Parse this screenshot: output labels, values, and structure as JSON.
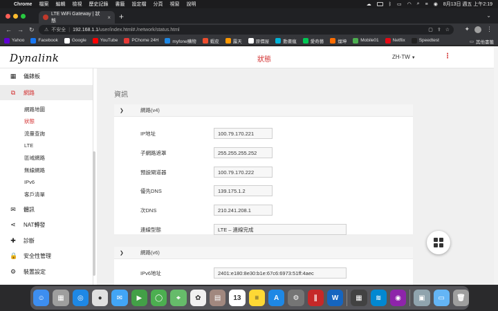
{
  "menubar": {
    "app": "Chrome",
    "menus": [
      "檔案",
      "編輯",
      "檢視",
      "歷史記錄",
      "書籤",
      "設定檔",
      "分頁",
      "視窗",
      "說明"
    ],
    "clock": "8月13日 週五 上午2:19"
  },
  "tab": {
    "title": "LTE WiFi Gateway | 狀態",
    "close": "×",
    "new": "+"
  },
  "toolbar": {
    "security": "不安全",
    "host": "192.168.1.1",
    "path": "/user/index.html#./network/status.html"
  },
  "bookmarks": [
    {
      "label": "Yahoo",
      "color": "#6001d2"
    },
    {
      "label": "Facebook",
      "color": "#1877f2"
    },
    {
      "label": "Google",
      "color": "#ffffff"
    },
    {
      "label": "YouTube",
      "color": "#ff0000"
    },
    {
      "label": "PChome 24H",
      "color": "#e53935"
    },
    {
      "label": "myfone購物",
      "color": "#1e88e5"
    },
    {
      "label": "蝦皮",
      "color": "#ee4d2d"
    },
    {
      "label": "露天",
      "color": "#ff9800"
    },
    {
      "label": "原價屋",
      "color": "#ffffff"
    },
    {
      "label": "動畫瘋",
      "color": "#00b4d8"
    },
    {
      "label": "愛奇藝",
      "color": "#00c853"
    },
    {
      "label": "燦坤",
      "color": "#ff6d00"
    },
    {
      "label": "Mobile01",
      "color": "#4caf50"
    },
    {
      "label": "Netflix",
      "color": "#e50914"
    },
    {
      "label": "Speedtest",
      "color": "#212121"
    }
  ],
  "other_bookmarks": "其他書籤",
  "header": {
    "logo": "Dynalink",
    "title": "狀態",
    "language": "ZH-TW"
  },
  "sidebar": {
    "items": [
      {
        "label": "儀錶板",
        "icon": "dashboard-icon"
      },
      {
        "label": "網路",
        "icon": "network-icon"
      },
      {
        "label": "體訊",
        "icon": "mail-icon"
      },
      {
        "label": "NAT轉發",
        "icon": "share-icon"
      },
      {
        "label": "診斷",
        "icon": "diagnostic-icon"
      },
      {
        "label": "安全性管理",
        "icon": "lock-icon"
      },
      {
        "label": "裝置設定",
        "icon": "gear-icon"
      }
    ],
    "subitems": [
      "網路地圖",
      "狀態",
      "流量查詢",
      "LTE",
      "區域網路",
      "無線網路",
      "IPv6",
      "客戶清單"
    ]
  },
  "main": {
    "section_title": "資訊",
    "v4": {
      "title": "網路(v4)",
      "rows": [
        {
          "label": "IP地址",
          "value": "100.79.170.221"
        },
        {
          "label": "子網路遮罩",
          "value": "255.255.255.252"
        },
        {
          "label": "預設閘道器",
          "value": "100.79.170.222"
        },
        {
          "label": "優先DNS",
          "value": "139.175.1.2"
        },
        {
          "label": "次DNS",
          "value": "210.241.208.1"
        },
        {
          "label": "連線型態",
          "value": "LTE – 連線完成"
        }
      ]
    },
    "v6": {
      "title": "網路(v6)",
      "rows": [
        {
          "label": "IPv6地址",
          "value": "2401:e180:8e30:b1e:67c6:6973:51ff:4aec"
        }
      ]
    }
  },
  "dock": [
    {
      "name": "finder",
      "color": "#3d8ef0",
      "glyph": "☺"
    },
    {
      "name": "launchpad",
      "color": "#9e9e9e",
      "glyph": "▦"
    },
    {
      "name": "safari",
      "color": "#1e88e5",
      "glyph": "◎"
    },
    {
      "name": "chrome",
      "color": "#e0e0e0",
      "glyph": "●"
    },
    {
      "name": "mail",
      "color": "#42a5f5",
      "glyph": "✉"
    },
    {
      "name": "facetime",
      "color": "#43a047",
      "glyph": "▶"
    },
    {
      "name": "messages",
      "color": "#4caf50",
      "glyph": "◯"
    },
    {
      "name": "maps",
      "color": "#66bb6a",
      "glyph": "⌖"
    },
    {
      "name": "photos",
      "color": "#f0f0f0",
      "glyph": "✿"
    },
    {
      "name": "notes-contacts",
      "color": "#a1887f",
      "glyph": "▤"
    },
    {
      "name": "calendar",
      "color": "#ffffff",
      "glyph": "13"
    },
    {
      "name": "notes",
      "color": "#fdd835",
      "glyph": "≡"
    },
    {
      "name": "app-store",
      "color": "#1e88e5",
      "glyph": "A"
    },
    {
      "name": "system-preferences",
      "color": "#757575",
      "glyph": "⚙"
    },
    {
      "name": "parallels",
      "color": "#c62828",
      "glyph": "∥"
    },
    {
      "name": "word",
      "color": "#1565c0",
      "glyph": "W"
    },
    {
      "name": "calculator",
      "color": "#424242",
      "glyph": "▦"
    },
    {
      "name": "wifi-explorer",
      "color": "#0288d1",
      "glyph": "≋"
    },
    {
      "name": "podcasts",
      "color": "#8e24aa",
      "glyph": "◉"
    },
    {
      "name": "preview",
      "color": "#90a4ae",
      "glyph": "▣"
    },
    {
      "name": "folder",
      "color": "#64b5f6",
      "glyph": "▭"
    },
    {
      "name": "trash",
      "color": "#9e9e9e",
      "glyph": "🗑"
    }
  ]
}
